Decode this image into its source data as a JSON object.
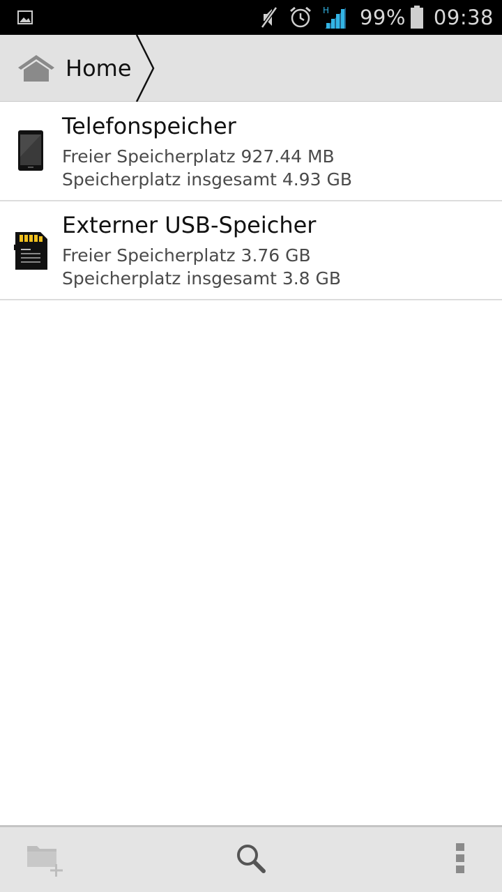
{
  "status_bar": {
    "notification_icon": "image-notification-icon",
    "icons": [
      "mute-icon",
      "alarm-icon",
      "signal-hspa-icon",
      "battery-icon"
    ],
    "network_type": "H",
    "battery_percent": "99%",
    "time": "09:38"
  },
  "breadcrumb": {
    "home_label": "Home",
    "home_icon": "home-icon"
  },
  "storage": [
    {
      "name": "Telefonspeicher",
      "icon": "phone-storage-icon",
      "free": "Freier Speicherplatz 927.44 MB",
      "total": "Speicherplatz insgesamt 4.93 GB"
    },
    {
      "name": "Externer USB-Speicher",
      "icon": "sd-card-icon",
      "free": "Freier Speicherplatz 3.76 GB",
      "total": "Speicherplatz insgesamt 3.8 GB"
    }
  ],
  "bottom_bar": {
    "new_folder_icon": "new-folder-icon",
    "search_icon": "search-icon",
    "menu_icon": "overflow-menu-icon"
  }
}
